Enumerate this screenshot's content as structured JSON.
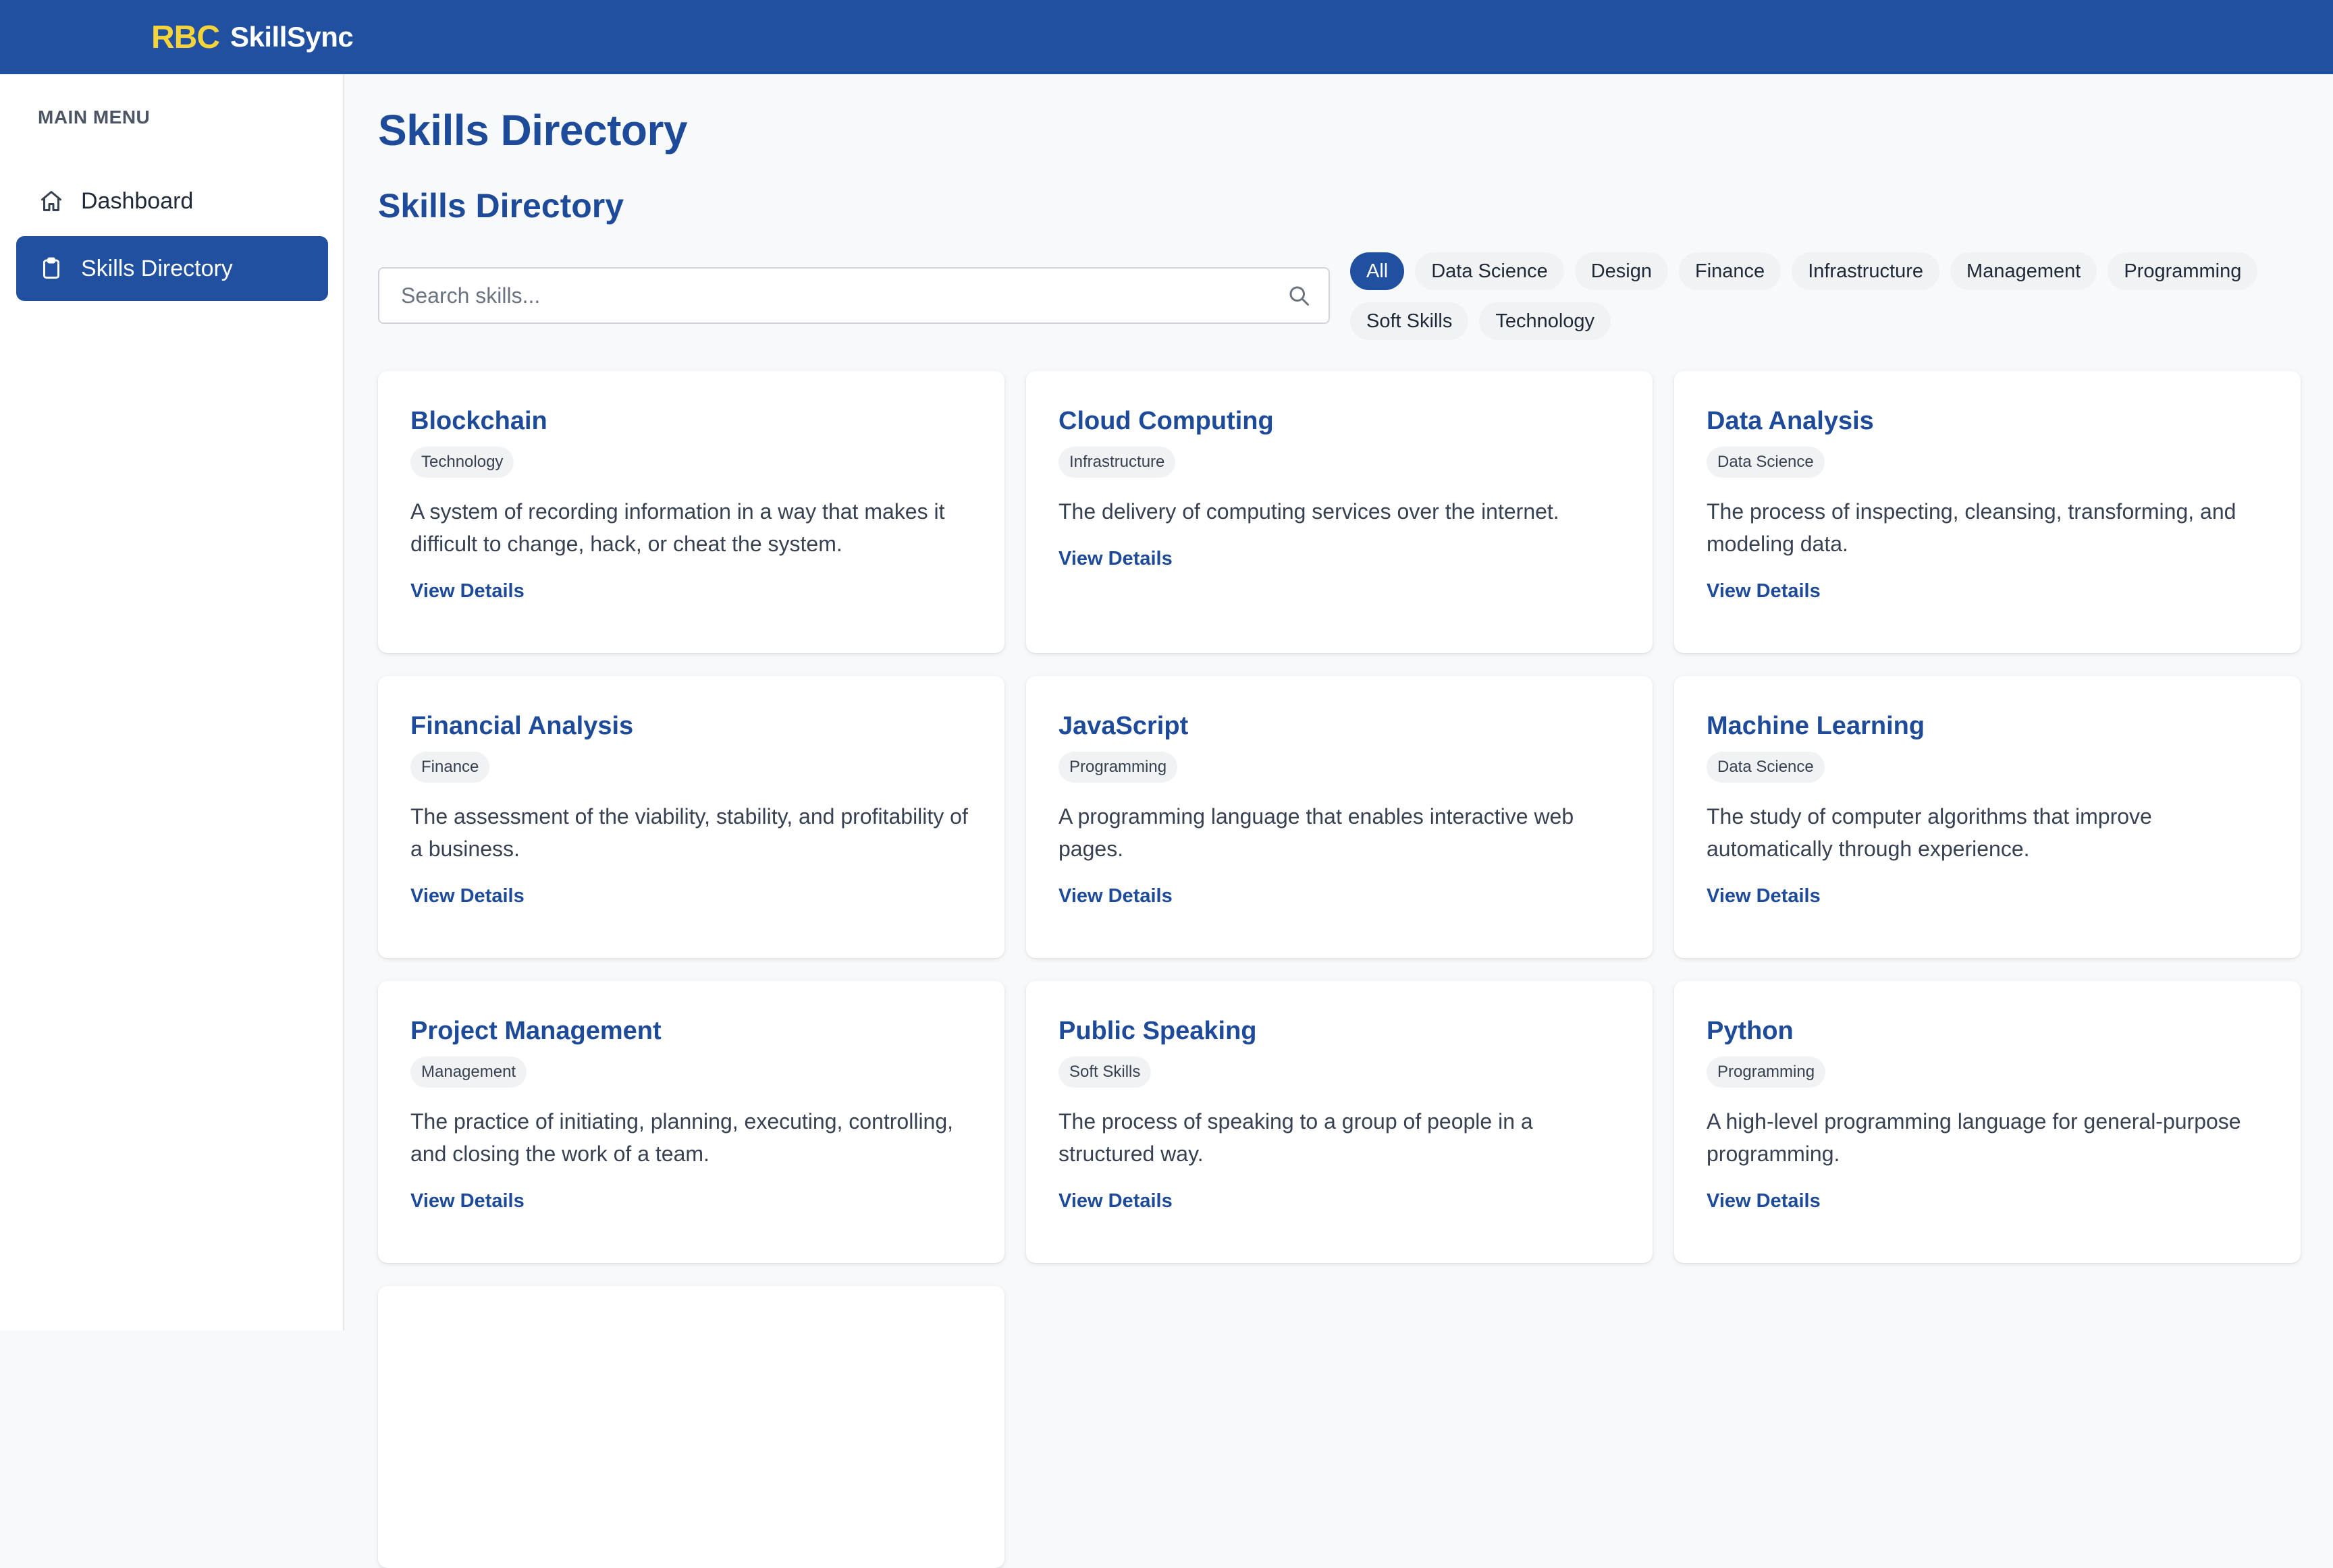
{
  "header": {
    "brand_mark": "RBC",
    "brand_name": "SkillSync",
    "brand_color": "#f5d33b",
    "bar_color": "#2150a0"
  },
  "sidebar": {
    "heading": "MAIN MENU",
    "items": [
      {
        "label": "Dashboard",
        "icon": "home-icon",
        "active": false
      },
      {
        "label": "Skills Directory",
        "icon": "clipboard-icon",
        "active": true
      }
    ]
  },
  "main": {
    "page_title": "Skills Directory",
    "section_title": "Skills Directory",
    "search": {
      "placeholder": "Search skills...",
      "value": ""
    },
    "filters": [
      {
        "label": "All",
        "active": true
      },
      {
        "label": "Data Science",
        "active": false
      },
      {
        "label": "Design",
        "active": false
      },
      {
        "label": "Finance",
        "active": false
      },
      {
        "label": "Infrastructure",
        "active": false
      },
      {
        "label": "Management",
        "active": false
      },
      {
        "label": "Programming",
        "active": false
      },
      {
        "label": "Soft Skills",
        "active": false
      },
      {
        "label": "Technology",
        "active": false
      }
    ],
    "cards": [
      {
        "title": "Blockchain",
        "category": "Technology",
        "description": "A system of recording information in a way that makes it difficult to change, hack, or cheat the system.",
        "link": "View Details"
      },
      {
        "title": "Cloud Computing",
        "category": "Infrastructure",
        "description": "The delivery of computing services over the internet.",
        "link": "View Details"
      },
      {
        "title": "Data Analysis",
        "category": "Data Science",
        "description": "The process of inspecting, cleansing, transforming, and modeling data.",
        "link": "View Details"
      },
      {
        "title": "Financial Analysis",
        "category": "Finance",
        "description": "The assessment of the viability, stability, and profitability of a business.",
        "link": "View Details"
      },
      {
        "title": "JavaScript",
        "category": "Programming",
        "description": "A programming language that enables interactive web pages.",
        "link": "View Details"
      },
      {
        "title": "Machine Learning",
        "category": "Data Science",
        "description": "The study of computer algorithms that improve automatically through experience.",
        "link": "View Details"
      },
      {
        "title": "Project Management",
        "category": "Management",
        "description": "The practice of initiating, planning, executing, controlling, and closing the work of a team.",
        "link": "View Details"
      },
      {
        "title": "Public Speaking",
        "category": "Soft Skills",
        "description": "The process of speaking to a group of people in a structured way.",
        "link": "View Details"
      },
      {
        "title": "Python",
        "category": "Programming",
        "description": "A high-level programming language for general-purpose programming.",
        "link": "View Details"
      }
    ]
  }
}
